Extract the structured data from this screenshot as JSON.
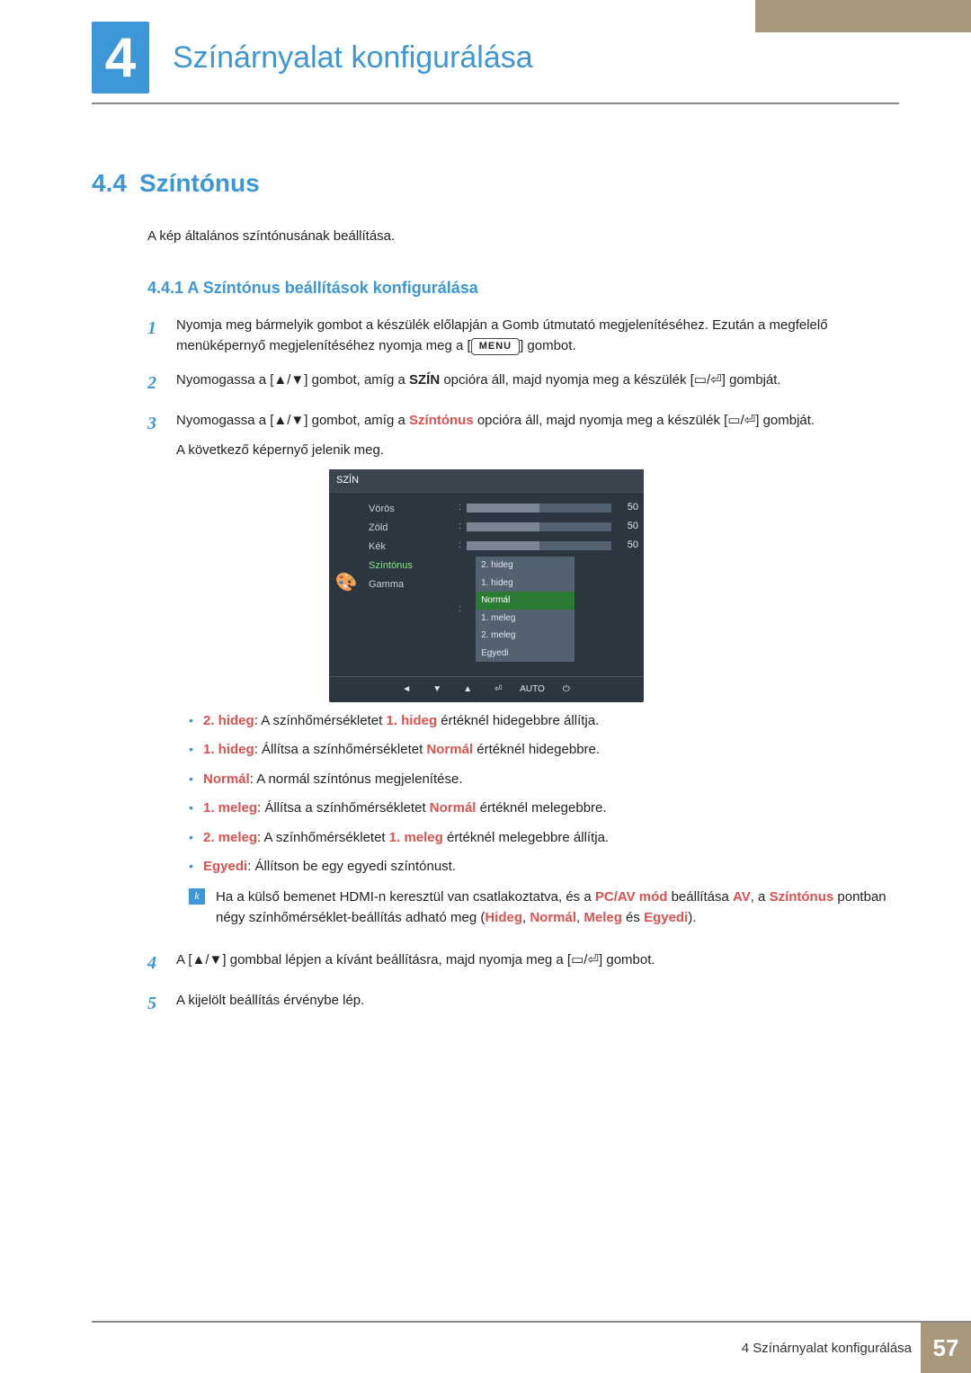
{
  "chapter": {
    "number": "4",
    "title": "Színárnyalat konfigurálása"
  },
  "section": {
    "number": "4.4",
    "title": "Színtónus"
  },
  "intro": "A kép általános színtónusának beállítása.",
  "subsection": {
    "number": "4.4.1",
    "title": "A Színtónus beállítások konfigurálása"
  },
  "steps": {
    "s1_a": "Nyomja meg bármelyik gombot a készülék előlapján a Gomb útmutató megjelenítéséhez. Ezután a megfelelő menüképernyő megjelenítéséhez nyomja meg a [",
    "s1_menu": "MENU",
    "s1_b": "] gombot.",
    "s2_a": "Nyomogassa a [",
    "s2_sym": "▲/▼",
    "s2_b": "] gombot, amíg a ",
    "s2_opt": "SZÍN",
    "s2_c": " opcióra áll, majd nyomja meg a készülék [",
    "s2_sym2": "▭/⏎",
    "s2_d": "] gombját.",
    "s3_a": "Nyomogassa a [",
    "s3_sym": "▲/▼",
    "s3_b": "] gombot, amíg a ",
    "s3_opt": "Színtónus",
    "s3_c": " opcióra áll, majd nyomja meg a készülék [",
    "s3_sym2": "▭/⏎",
    "s3_d": "] gombját.",
    "s3_follow": "A következő képernyő jelenik meg.",
    "s4_a": "A [",
    "s4_sym": "▲/▼",
    "s4_b": "] gombbal lépjen a kívánt beállításra, majd nyomja meg a [",
    "s4_sym2": "▭/⏎",
    "s4_c": "] gombot.",
    "s5": "A kijelölt beállítás érvénybe lép."
  },
  "osd": {
    "title": "SZÍN",
    "rows": [
      "Vörös",
      "Zöld",
      "Kék",
      "Színtónus",
      "Gamma"
    ],
    "values": [
      "50",
      "50",
      "50"
    ],
    "options": [
      "2. hideg",
      "1. hideg",
      "Normál",
      "1. meleg",
      "2. meleg",
      "Egyedi"
    ],
    "auto": "AUTO",
    "palette_glyph": "🎨"
  },
  "bullets": {
    "b1_t": "2. hideg",
    "b1_a": ": A színhőmérsékletet ",
    "b1_r": "1. hideg",
    "b1_b": " értéknél hidegebbre állítja.",
    "b2_t": "1. hideg",
    "b2_a": ": Állítsa a színhőmérsékletet ",
    "b2_r": "Normál",
    "b2_b": " értéknél hidegebbre.",
    "b3_t": "Normál",
    "b3_a": ": A normál színtónus megjelenítése.",
    "b4_t": "1. meleg",
    "b4_a": ": Állítsa a színhőmérsékletet ",
    "b4_r": "Normál",
    "b4_b": " értéknél melegebbre.",
    "b5_t": "2. meleg",
    "b5_a": ": A színhőmérsékletet ",
    "b5_r": "1. meleg",
    "b5_b": " értéknél melegebbre állítja.",
    "b6_t": "Egyedi",
    "b6_a": ": Állítson be egy egyedi színtónust."
  },
  "note": {
    "a": "Ha a külső bemenet HDMI-n keresztül van csatlakoztatva, és a ",
    "m1": "PC/AV mód",
    "b": " beállítása ",
    "m2": "AV",
    "c": ", a ",
    "m3": "Színtónus",
    "d": " pontban négy színhőmérséklet-beállítás adható meg (",
    "o1": "Hideg",
    "sep1": ", ",
    "o2": "Normál",
    "sep2": ", ",
    "o3": "Meleg",
    "sep3": " és ",
    "o4": "Egyedi",
    "e": ")."
  },
  "footer": {
    "chapter_label": "4 Színárnyalat konfigurálása",
    "page": "57"
  }
}
